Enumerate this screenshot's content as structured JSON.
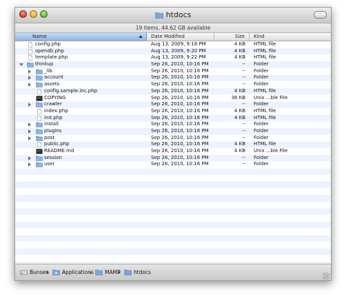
{
  "window": {
    "title": "htdocs",
    "status": "19 items, 44.62 GB available"
  },
  "columns": {
    "name": "Name",
    "date": "Date Modified",
    "size": "Size",
    "kind": "Kind"
  },
  "files": [
    {
      "name": "config.php",
      "date": "Aug 13, 2009, 9:18 PM",
      "size": "4 KB",
      "kind": "HTML file",
      "type": "file",
      "depth": 0,
      "disclosure": "none"
    },
    {
      "name": "opendb.php",
      "date": "Aug 13, 2009, 9:20 PM",
      "size": "4 KB",
      "kind": "HTML file",
      "type": "file",
      "depth": 0,
      "disclosure": "none"
    },
    {
      "name": "template.php",
      "date": "Aug 13, 2009, 9:22 PM",
      "size": "4 KB",
      "kind": "HTML file",
      "type": "file",
      "depth": 0,
      "disclosure": "none"
    },
    {
      "name": "thinkup",
      "date": "Sep 26, 2010, 10:16 PM",
      "size": "--",
      "kind": "Folder",
      "type": "folder",
      "depth": 0,
      "disclosure": "open"
    },
    {
      "name": "_lib",
      "date": "Sep 26, 2010, 10:16 PM",
      "size": "--",
      "kind": "Folder",
      "type": "folder",
      "depth": 1,
      "disclosure": "closed"
    },
    {
      "name": "account",
      "date": "Sep 26, 2010, 10:16 PM",
      "size": "--",
      "kind": "Folder",
      "type": "folder",
      "depth": 1,
      "disclosure": "closed"
    },
    {
      "name": "assets",
      "date": "Sep 26, 2010, 10:16 PM",
      "size": "--",
      "kind": "Folder",
      "type": "folder",
      "depth": 1,
      "disclosure": "closed"
    },
    {
      "name": "config.sample.inc.php",
      "date": "Sep 26, 2010, 10:16 PM",
      "size": "4 KB",
      "kind": "HTML file",
      "type": "file",
      "depth": 1,
      "disclosure": "none"
    },
    {
      "name": "COPYING",
      "date": "Sep 26, 2010, 10:16 PM",
      "size": "36 KB",
      "kind": "Unix ...ble File",
      "type": "exec",
      "depth": 1,
      "disclosure": "none"
    },
    {
      "name": "crawler",
      "date": "Sep 26, 2010, 10:16 PM",
      "size": "--",
      "kind": "Folder",
      "type": "folder",
      "depth": 1,
      "disclosure": "closed"
    },
    {
      "name": "index.php",
      "date": "Sep 26, 2010, 10:16 PM",
      "size": "4 KB",
      "kind": "HTML file",
      "type": "file",
      "depth": 1,
      "disclosure": "none"
    },
    {
      "name": "init.php",
      "date": "Sep 26, 2010, 10:16 PM",
      "size": "4 KB",
      "kind": "HTML file",
      "type": "file",
      "depth": 1,
      "disclosure": "none"
    },
    {
      "name": "install",
      "date": "Sep 26, 2010, 10:16 PM",
      "size": "--",
      "kind": "Folder",
      "type": "folder",
      "depth": 1,
      "disclosure": "closed"
    },
    {
      "name": "plugins",
      "date": "Sep 26, 2010, 10:16 PM",
      "size": "--",
      "kind": "Folder",
      "type": "folder",
      "depth": 1,
      "disclosure": "closed"
    },
    {
      "name": "post",
      "date": "Sep 26, 2010, 10:16 PM",
      "size": "--",
      "kind": "Folder",
      "type": "folder",
      "depth": 1,
      "disclosure": "closed"
    },
    {
      "name": "public.php",
      "date": "Sep 26, 2010, 10:16 PM",
      "size": "4 KB",
      "kind": "HTML file",
      "type": "file",
      "depth": 1,
      "disclosure": "none"
    },
    {
      "name": "README.md",
      "date": "Sep 26, 2010, 10:16 PM",
      "size": "4 KB",
      "kind": "Unix ...ble File",
      "type": "exec",
      "depth": 1,
      "disclosure": "none"
    },
    {
      "name": "session",
      "date": "Sep 26, 2010, 10:16 PM",
      "size": "--",
      "kind": "Folder",
      "type": "folder",
      "depth": 1,
      "disclosure": "closed"
    },
    {
      "name": "user",
      "date": "Sep 26, 2010, 10:16 PM",
      "size": "--",
      "kind": "Folder",
      "type": "folder",
      "depth": 1,
      "disclosure": "closed"
    }
  ],
  "path": [
    {
      "label": "Bunsen",
      "icon": "hard-drive-icon"
    },
    {
      "label": "Applications",
      "icon": "applications-folder-icon"
    },
    {
      "label": "MAMP",
      "icon": "folder-icon"
    },
    {
      "label": "htdocs",
      "icon": "folder-icon"
    }
  ],
  "colors": {
    "folder": "#7fa6d8",
    "stripe": "#edf3fe",
    "header_selected": "#8fb3e8"
  }
}
